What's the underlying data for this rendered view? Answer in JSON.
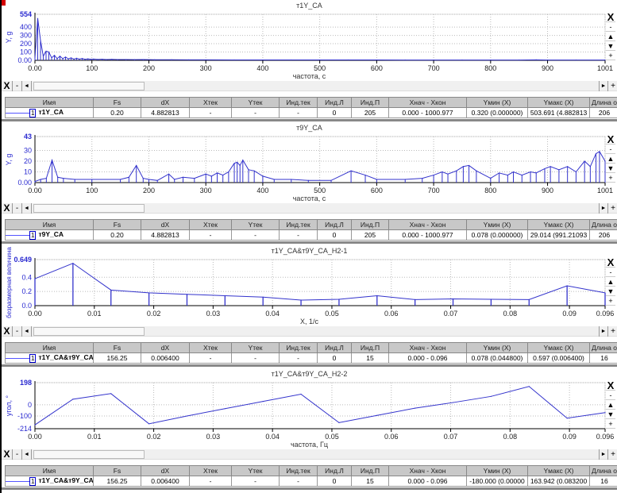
{
  "table_headers": [
    "Имя",
    "Fs",
    "dX",
    "Xтек",
    "Yтек",
    "Инд.тек",
    "Инд.Л",
    "Инд.П",
    "Xнач - Xкон",
    "Yмин (X)",
    "Yмакс (X)",
    "Длина о"
  ],
  "controls": {
    "close": "X",
    "minus": "-",
    "up": "▲",
    "down": "▼",
    "plus": "+",
    "left": "◄",
    "right": "►"
  },
  "colors": {
    "series": "#3333cc",
    "axis": "#2a2ad0",
    "grid": "#bbbbbb",
    "header": "#c8c8c8"
  },
  "chart_data": [
    {
      "type": "line",
      "title": "т1Y_CA",
      "xlabel": "частота, с",
      "ylabel": "Y, g",
      "xlim": [
        0,
        1001
      ],
      "ylim": [
        0,
        554
      ],
      "xticks": [
        "0.00",
        "100",
        "200",
        "300",
        "400",
        "500",
        "600",
        "700",
        "800",
        "900",
        "1001"
      ],
      "xtick_values": [
        0,
        100,
        200,
        300,
        400,
        500,
        600,
        700,
        800,
        900,
        1001
      ],
      "yticks": [
        "0.00",
        "100",
        "200",
        "300",
        "400",
        "554"
      ],
      "ytick_values": [
        0,
        100,
        200,
        300,
        400,
        554
      ],
      "stems": true,
      "points": [
        [
          0,
          30
        ],
        [
          4.88,
          504
        ],
        [
          9.77,
          240
        ],
        [
          14.6,
          50
        ],
        [
          19.5,
          110
        ],
        [
          24.4,
          100
        ],
        [
          29.3,
          30
        ],
        [
          34.2,
          60
        ],
        [
          39,
          20
        ],
        [
          43.9,
          50
        ],
        [
          48.8,
          20
        ],
        [
          53.7,
          40
        ],
        [
          58.6,
          18
        ],
        [
          63.5,
          30
        ],
        [
          68.4,
          15
        ],
        [
          73.2,
          25
        ],
        [
          78,
          14
        ],
        [
          83,
          22
        ],
        [
          88,
          12
        ],
        [
          93,
          18
        ],
        [
          98,
          12
        ],
        [
          103,
          15
        ],
        [
          110,
          11
        ],
        [
          118,
          13
        ],
        [
          125,
          10
        ],
        [
          135,
          12
        ],
        [
          145,
          9
        ],
        [
          160,
          10
        ],
        [
          175,
          8
        ],
        [
          190,
          9
        ],
        [
          210,
          7
        ],
        [
          240,
          7
        ],
        [
          270,
          6
        ],
        [
          300,
          6
        ],
        [
          350,
          5
        ],
        [
          400,
          5
        ],
        [
          450,
          5
        ],
        [
          500,
          5
        ],
        [
          550,
          5
        ],
        [
          600,
          5
        ],
        [
          650,
          4
        ],
        [
          700,
          4
        ],
        [
          750,
          4
        ],
        [
          800,
          4
        ],
        [
          850,
          4
        ],
        [
          880,
          6
        ],
        [
          900,
          4
        ],
        [
          950,
          4
        ],
        [
          1001,
          4
        ]
      ]
    },
    {
      "type": "line",
      "title": "т9Y_CA",
      "xlabel": "частота, с",
      "ylabel": "Y, g",
      "xlim": [
        0,
        1001
      ],
      "ylim": [
        0,
        43
      ],
      "xticks": [
        "0.00",
        "100",
        "200",
        "300",
        "400",
        "500",
        "600",
        "700",
        "800",
        "900",
        "1001"
      ],
      "xtick_values": [
        0,
        100,
        200,
        300,
        400,
        500,
        600,
        700,
        800,
        900,
        1001
      ],
      "yticks": [
        "0.00",
        "10",
        "20",
        "30",
        "43"
      ],
      "ytick_values": [
        0,
        10,
        20,
        30,
        43
      ],
      "stems": true,
      "points": [
        [
          0,
          1
        ],
        [
          10,
          3
        ],
        [
          20,
          4
        ],
        [
          30,
          21
        ],
        [
          40,
          5
        ],
        [
          50,
          4
        ],
        [
          70,
          3
        ],
        [
          100,
          3
        ],
        [
          150,
          3
        ],
        [
          165,
          5
        ],
        [
          178,
          16
        ],
        [
          190,
          4
        ],
        [
          200,
          3
        ],
        [
          215,
          2
        ],
        [
          235,
          8
        ],
        [
          245,
          3
        ],
        [
          260,
          5
        ],
        [
          280,
          4
        ],
        [
          300,
          8
        ],
        [
          310,
          6
        ],
        [
          320,
          9
        ],
        [
          330,
          7
        ],
        [
          340,
          10
        ],
        [
          350,
          18
        ],
        [
          355,
          19
        ],
        [
          360,
          16
        ],
        [
          365,
          21
        ],
        [
          375,
          12
        ],
        [
          385,
          11
        ],
        [
          400,
          6
        ],
        [
          420,
          3
        ],
        [
          450,
          3
        ],
        [
          480,
          2
        ],
        [
          520,
          2
        ],
        [
          555,
          11
        ],
        [
          580,
          7
        ],
        [
          600,
          3
        ],
        [
          650,
          3
        ],
        [
          680,
          4
        ],
        [
          700,
          7
        ],
        [
          715,
          10
        ],
        [
          725,
          8
        ],
        [
          740,
          11
        ],
        [
          752,
          15
        ],
        [
          762,
          16
        ],
        [
          775,
          11
        ],
        [
          800,
          4
        ],
        [
          815,
          9
        ],
        [
          830,
          7
        ],
        [
          840,
          10
        ],
        [
          855,
          7
        ],
        [
          870,
          10
        ],
        [
          880,
          9
        ],
        [
          895,
          13
        ],
        [
          905,
          15
        ],
        [
          920,
          12
        ],
        [
          935,
          15
        ],
        [
          950,
          10
        ],
        [
          965,
          20
        ],
        [
          975,
          15
        ],
        [
          985,
          27
        ],
        [
          991.2,
          29.014
        ],
        [
          1001,
          20
        ]
      ]
    },
    {
      "type": "line",
      "title": "т1Y_CA&т9Y_CA_H2-1",
      "xlabel": "X, 1/c",
      "ylabel": "безразмерная величина",
      "xlim": [
        0,
        0.096
      ],
      "ylim": [
        0,
        0.649
      ],
      "xticks": [
        "0.00",
        "0.01",
        "0.02",
        "0.03",
        "0.04",
        "0.05",
        "0.06",
        "0.07",
        "0.08",
        "0.09",
        "0.096"
      ],
      "xtick_values": [
        0,
        0.01,
        0.02,
        0.03,
        0.04,
        0.05,
        0.06,
        0.07,
        0.08,
        0.09,
        0.096
      ],
      "yticks": [
        "0.0",
        "0.2",
        "0.4",
        "0.649"
      ],
      "ytick_values": [
        0,
        0.2,
        0.4,
        0.649
      ],
      "stems": true,
      "points": [
        [
          0,
          0.38
        ],
        [
          0.0064,
          0.597
        ],
        [
          0.0128,
          0.22
        ],
        [
          0.0192,
          0.18
        ],
        [
          0.0256,
          0.16
        ],
        [
          0.032,
          0.14
        ],
        [
          0.0384,
          0.12
        ],
        [
          0.0448,
          0.078
        ],
        [
          0.0512,
          0.09
        ],
        [
          0.0576,
          0.14
        ],
        [
          0.064,
          0.085
        ],
        [
          0.0704,
          0.095
        ],
        [
          0.0768,
          0.09
        ],
        [
          0.0832,
          0.085
        ],
        [
          0.0896,
          0.28
        ],
        [
          0.096,
          0.18
        ]
      ]
    },
    {
      "type": "line",
      "title": "т1Y_CA&т9Y_CA_H2-2",
      "xlabel": "частота, Гц",
      "ylabel": "угол, °",
      "xlim": [
        0,
        0.096
      ],
      "ylim": [
        -214,
        198
      ],
      "xticks": [
        "0.00",
        "0.01",
        "0.02",
        "0.03",
        "0.04",
        "0.05",
        "0.06",
        "0.07",
        "0.08",
        "0.09",
        "0.096"
      ],
      "xtick_values": [
        0,
        0.01,
        0.02,
        0.03,
        0.04,
        0.05,
        0.06,
        0.07,
        0.08,
        0.09,
        0.096
      ],
      "yticks": [
        "-214",
        "-100",
        "0",
        "198"
      ],
      "ytick_values": [
        -214,
        -100,
        0,
        198
      ],
      "stems": false,
      "points": [
        [
          0,
          -180
        ],
        [
          0.0064,
          50
        ],
        [
          0.0128,
          100
        ],
        [
          0.0192,
          -170
        ],
        [
          0.0256,
          -100
        ],
        [
          0.032,
          -35
        ],
        [
          0.0384,
          30
        ],
        [
          0.0448,
          95
        ],
        [
          0.0512,
          -160
        ],
        [
          0.0576,
          -95
        ],
        [
          0.064,
          -30
        ],
        [
          0.0704,
          20
        ],
        [
          0.0768,
          75
        ],
        [
          0.0832,
          163.942
        ],
        [
          0.0896,
          -120
        ],
        [
          0.096,
          -70
        ]
      ]
    }
  ],
  "tables": [
    {
      "row": [
        "т1Y_CA",
        "0.20",
        "4.882813",
        "-",
        "-",
        "-",
        "0",
        "205",
        "0.000 - 1000.977",
        "0.320 (0.000000)",
        "503.691 (4.882813",
        "206"
      ]
    },
    {
      "row": [
        "т9Y_CA",
        "0.20",
        "4.882813",
        "-",
        "-",
        "-",
        "0",
        "205",
        "0.000 - 1000.977",
        "0.078 (0.000000)",
        "29.014 (991.21093",
        "206"
      ]
    },
    {
      "row": [
        "т1Y_CA&т9Y_CA_",
        "156.25",
        "0.006400",
        "-",
        "-",
        "-",
        "0",
        "15",
        "0.000 - 0.096",
        "0.078 (0.044800)",
        "0.597 (0.006400)",
        "16"
      ]
    },
    {
      "row": [
        "т1Y_CA&т9Y_CA_",
        "156.25",
        "0.006400",
        "-",
        "-",
        "-",
        "0",
        "15",
        "0.000 - 0.096",
        "-180.000 (0.00000",
        "163.942 (0.083200",
        "16"
      ]
    }
  ],
  "row_index": "1"
}
